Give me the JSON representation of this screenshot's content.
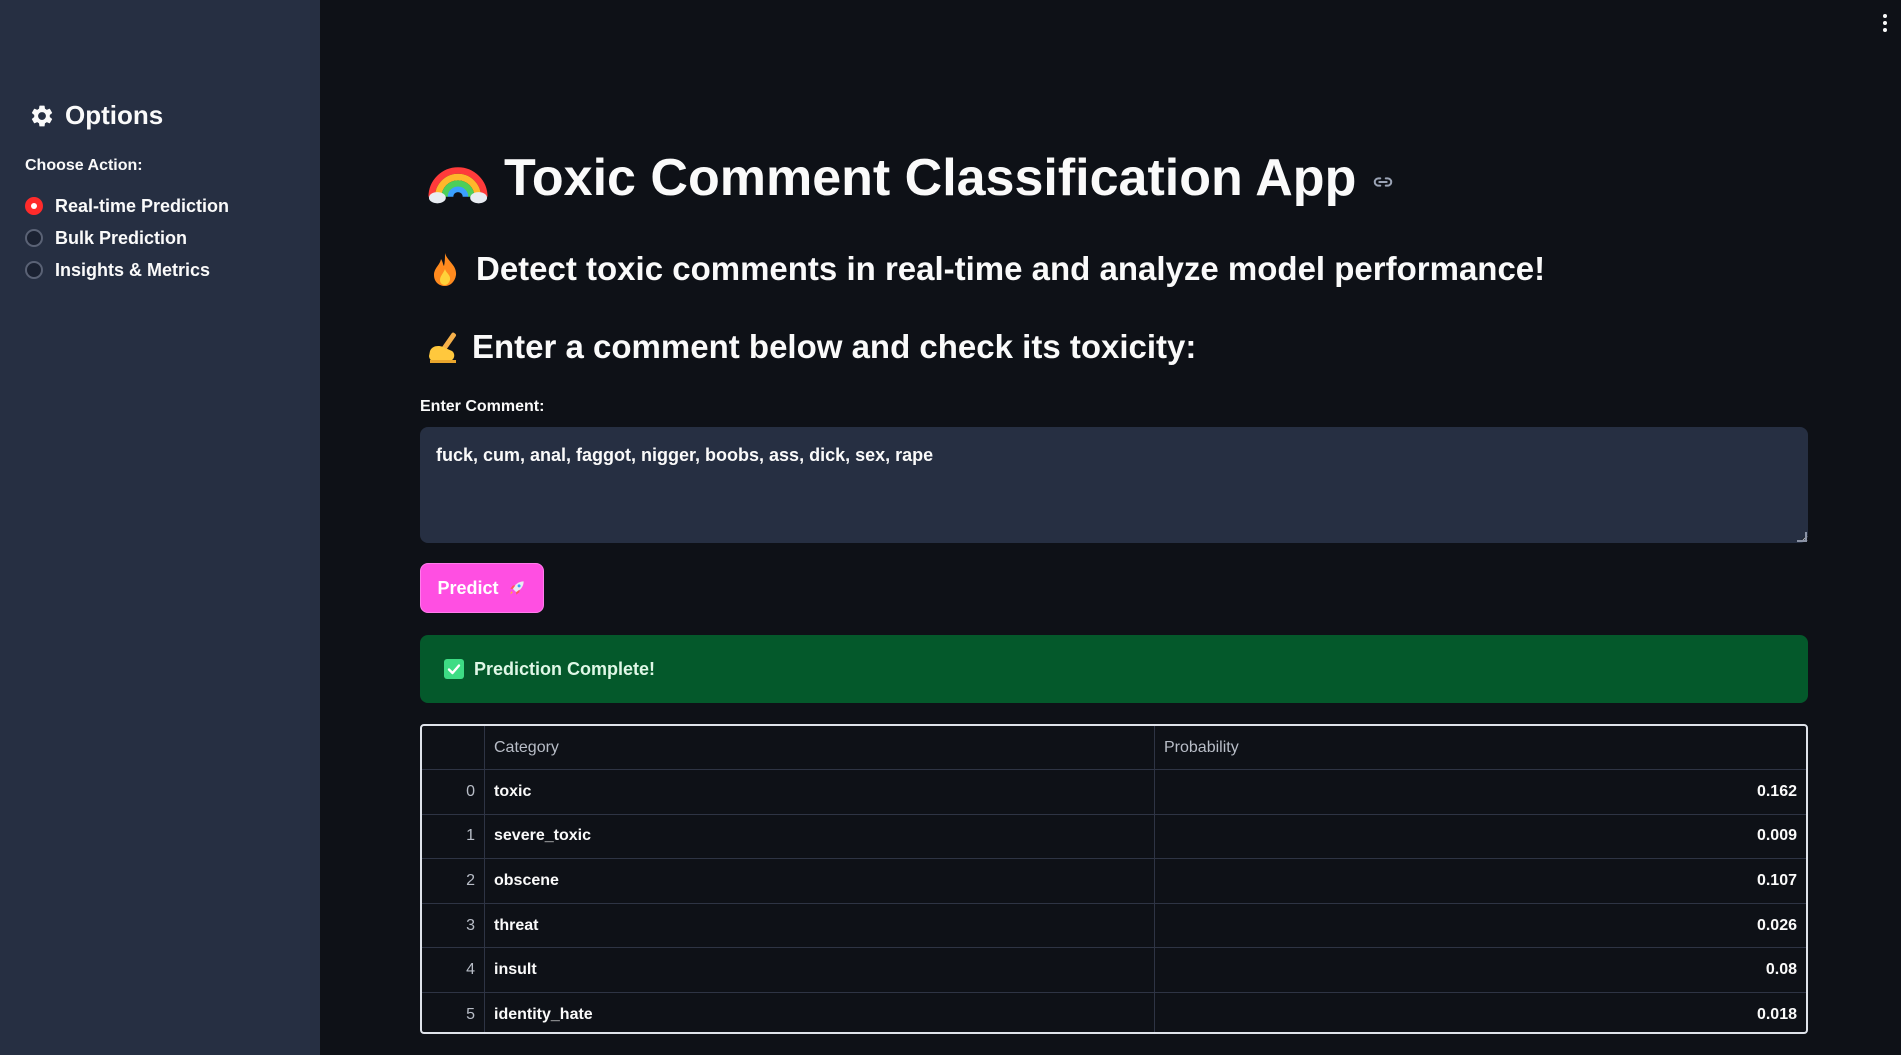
{
  "sidebar": {
    "header": "Options",
    "choose_label": "Choose Action:",
    "options": [
      {
        "label": "Real-time Prediction",
        "selected": true
      },
      {
        "label": "Bulk Prediction",
        "selected": false
      },
      {
        "label": "Insights & Metrics",
        "selected": false
      }
    ]
  },
  "main": {
    "title": "Toxic Comment Classification App",
    "subtitle": "Detect toxic comments in real-time and analyze model performance!",
    "instruction": "Enter a comment below and check its toxicity:",
    "comment_label": "Enter Comment:",
    "comment_value": "fuck, cum, anal, faggot, nigger, boobs, ass, dick, sex, rape",
    "predict_label": "Predict",
    "success_message": "Prediction Complete!",
    "table": {
      "headers": [
        "",
        "Category",
        "Probability"
      ],
      "rows": [
        {
          "index": "0",
          "category": "toxic",
          "probability": "0.162"
        },
        {
          "index": "1",
          "category": "severe_toxic",
          "probability": "0.009"
        },
        {
          "index": "2",
          "category": "obscene",
          "probability": "0.107"
        },
        {
          "index": "3",
          "category": "threat",
          "probability": "0.026"
        },
        {
          "index": "4",
          "category": "insult",
          "probability": "0.08"
        },
        {
          "index": "5",
          "category": "identity_hate",
          "probability": "0.018"
        }
      ]
    }
  },
  "colors": {
    "background": "#0e1117",
    "sidebar": "#262f42",
    "accent_radio": "#ff2b2b",
    "predict_button": "#ff4fe2",
    "success_bg": "#04592b"
  },
  "icons": {
    "sidebar_header": "gear-icon",
    "title": "rainbow-emoji",
    "subtitle": "fire-emoji",
    "instruction": "writing-hand-emoji",
    "predict": "rocket-emoji",
    "success": "check-mark-icon",
    "anchor": "link-icon",
    "menu": "kebab-menu-icon"
  }
}
